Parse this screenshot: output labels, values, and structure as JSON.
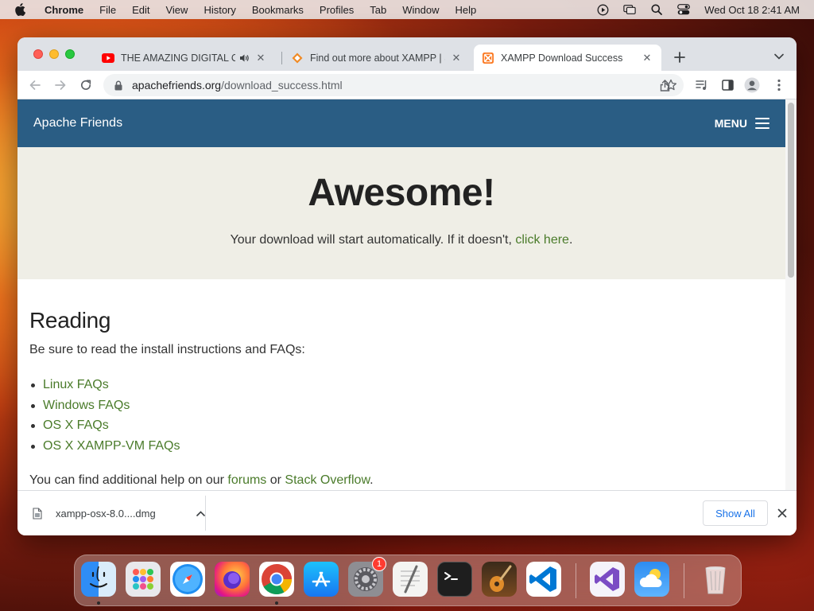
{
  "menubar": {
    "app_name": "Chrome",
    "items": [
      "File",
      "Edit",
      "View",
      "History",
      "Bookmarks",
      "Profiles",
      "Tab",
      "Window",
      "Help"
    ],
    "datetime": "Wed Oct 18  2:41 AM"
  },
  "browser": {
    "tabs": [
      {
        "title": "THE AMAZING DIGITAL CIRCUS",
        "favicon": "youtube-icon",
        "audio": true,
        "active": false
      },
      {
        "title": "Find out more about XAMPP | S",
        "favicon": "bitnami-icon",
        "audio": false,
        "active": false
      },
      {
        "title": "XAMPP Download Success",
        "favicon": "xampp-icon",
        "audio": false,
        "active": true
      }
    ],
    "address_bar": {
      "domain": "apachefriends.org",
      "path": "/download_success.html"
    }
  },
  "page": {
    "header": {
      "brand": "Apache Friends",
      "menu_label": "MENU"
    },
    "hero": {
      "title": "Awesome!",
      "lead_text": "Your download will start automatically. If it doesn't, ",
      "lead_link": "click here",
      "lead_end": "."
    },
    "reading": {
      "heading": "Reading",
      "intro": "Be sure to read the install instructions and FAQs:",
      "links": [
        "Linux FAQs",
        "Windows FAQs",
        "OS X FAQs",
        "OS X XAMPP-VM FAQs"
      ],
      "help_text_start": "You can find additional help on our ",
      "help_link_forums": "forums",
      "help_text_mid": " or ",
      "help_link_so": "Stack Overflow",
      "help_text_end": "."
    }
  },
  "download_shelf": {
    "file_name": "xampp-osx-8.0....dmg",
    "show_all_label": "Show All"
  },
  "dock": {
    "apps": [
      "Finder",
      "Launchpad",
      "Safari",
      "Firefox",
      "Chrome",
      "App Store",
      "System Preferences",
      "TextEdit",
      "Terminal",
      "GarageBand",
      "Visual Studio Code",
      "Visual Studio",
      "Weather",
      "Trash"
    ],
    "system_preferences_badge": "1"
  },
  "colors": {
    "site_header": "#2a5d84",
    "hero_bg": "#efeee6",
    "link_green": "#4a7b2a",
    "chrome_blue": "#1a73e8"
  }
}
